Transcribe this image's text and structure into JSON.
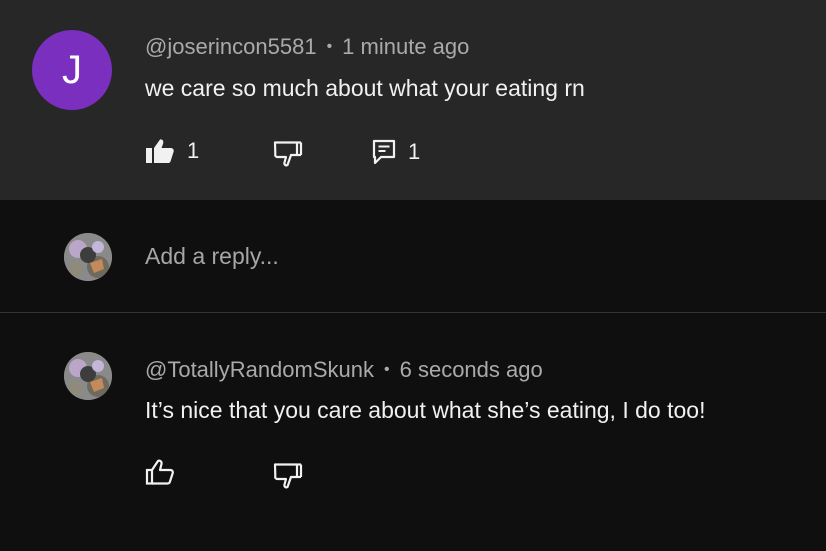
{
  "comment": {
    "avatar_letter": "J",
    "author": "@joserincon5581",
    "separator": "•",
    "time": "1 minute ago",
    "text": "we care so much about what your eating rn",
    "like_count": "1",
    "reply_count": "1"
  },
  "reply_box": {
    "placeholder": "Add a reply..."
  },
  "reply": {
    "author": "@TotallyRandomSkunk",
    "separator": "•",
    "time": "6 seconds ago",
    "text": "It’s nice that you care about what she’s eating, I do too!"
  },
  "icons": {
    "like_filled": "thumbs-up-filled-icon",
    "dislike": "thumbs-down-icon",
    "replies": "comment-icon",
    "like_outline": "thumbs-up-outline-icon"
  },
  "colors": {
    "avatar_purple": "#7b2fbe",
    "comment_bg": "#272727",
    "page_bg": "#0f0f0f"
  }
}
